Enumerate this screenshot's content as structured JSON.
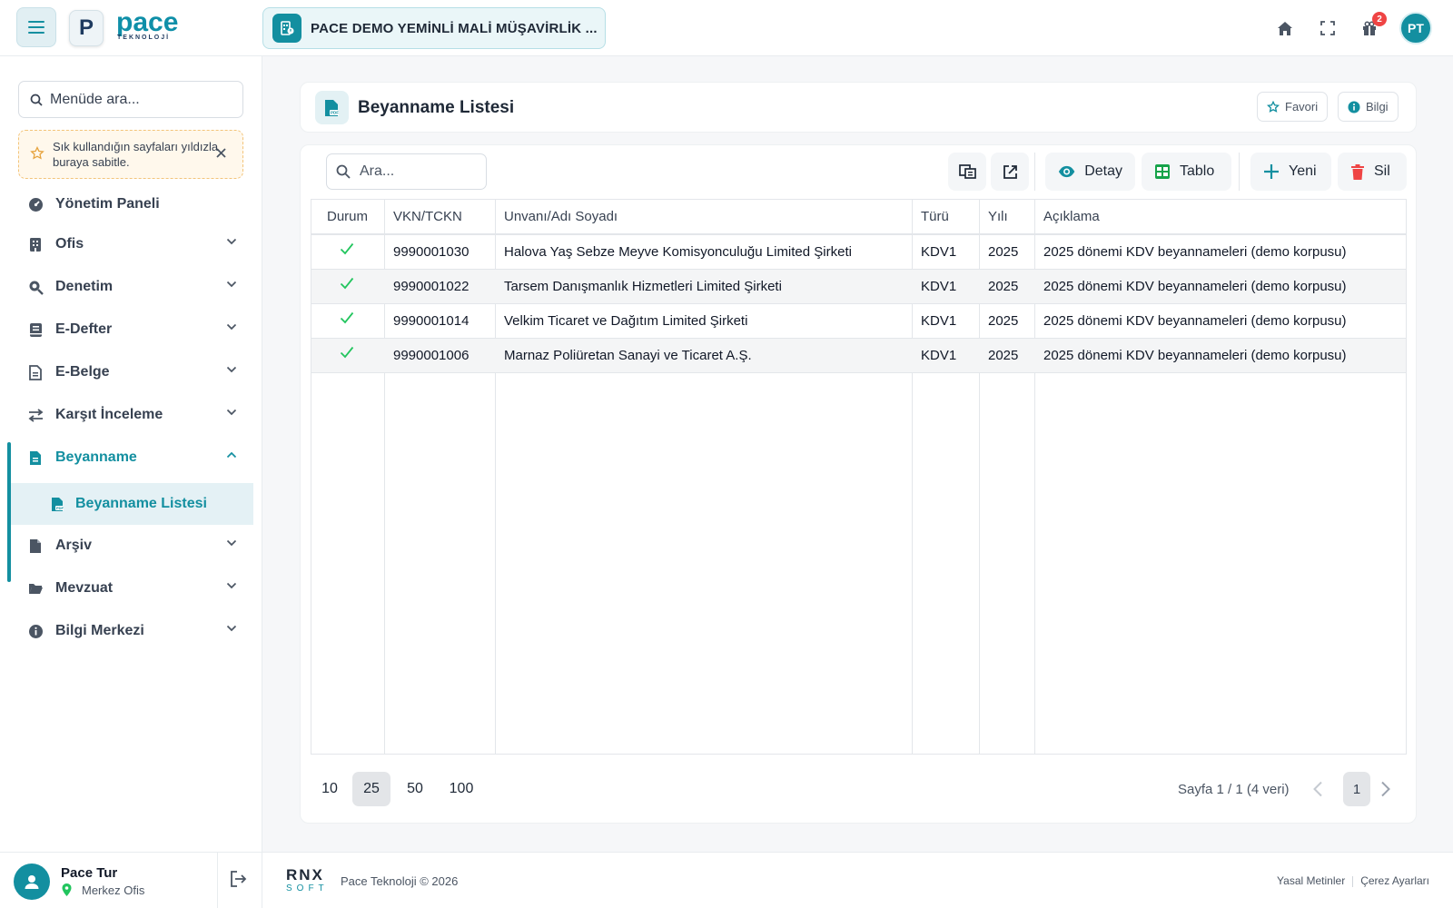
{
  "topbar": {
    "brand": "pace",
    "brand_sub": "TEKNOLOJİ",
    "logo_letter": "P",
    "office_name": "PACE DEMO YEMİNLİ MALİ MÜŞAVİRLİK ...",
    "notification_count": "2",
    "avatar_initials": "PT",
    "accent_color": "#138fa0"
  },
  "sidebar": {
    "search_placeholder": "Menüde ara...",
    "tip_text": "Sık kullandığın sayfaları yıldızla buraya sabitle.",
    "items": [
      {
        "label": "Yönetim Paneli",
        "icon": "gauge-icon"
      },
      {
        "label": "Ofis",
        "icon": "building-icon"
      },
      {
        "label": "Denetim",
        "icon": "audit-search-icon"
      },
      {
        "label": "E-Defter",
        "icon": "book-icon"
      },
      {
        "label": "E-Belge",
        "icon": "document-icon"
      },
      {
        "label": "Karşıt İnceleme",
        "icon": "arrows-exchange-icon"
      },
      {
        "label": "Beyanname",
        "icon": "file-text-icon"
      },
      {
        "label": "Arşiv",
        "icon": "archive-file-icon"
      },
      {
        "label": "Mevzuat",
        "icon": "folder-open-icon"
      },
      {
        "label": "Bilgi Merkezi",
        "icon": "info-circle-icon"
      }
    ],
    "sub_item": {
      "label": "Beyanname Listesi",
      "icon": "pdf-file-icon"
    }
  },
  "user": {
    "name": "Pace Tur",
    "office": "Merkez Ofis"
  },
  "footer": {
    "logo_text": "RNX",
    "logo_sub": "SOFT",
    "copyright": "Pace Teknoloji © 2026",
    "link_legal": "Yasal Metinler",
    "link_cookies": "Çerez Ayarları"
  },
  "page": {
    "title": "Beyanname Listesi",
    "favorite_label": "Favori",
    "info_label": "Bilgi"
  },
  "toolbar": {
    "search_placeholder": "Ara...",
    "detail_label": "Detay",
    "table_label": "Tablo",
    "new_label": "Yeni",
    "delete_label": "Sil"
  },
  "table": {
    "columns": [
      "Durum",
      "VKN/TCKN",
      "Unvanı/Adı Soyadı",
      "Türü",
      "Yılı",
      "Açıklama"
    ],
    "rows": [
      {
        "status": "ok",
        "vkn": "9990001030",
        "name": "Halova Yaş Sebze Meyve Komisyonculuğu Limited Şirketi",
        "type": "KDV1",
        "year": "2025",
        "desc": "2025 dönemi KDV beyannameleri (demo korpusu)"
      },
      {
        "status": "ok",
        "vkn": "9990001022",
        "name": "Tarsem Danışmanlık Hizmetleri Limited Şirketi",
        "type": "KDV1",
        "year": "2025",
        "desc": "2025 dönemi KDV beyannameleri (demo korpusu)"
      },
      {
        "status": "ok",
        "vkn": "9990001014",
        "name": "Velkim Ticaret ve Dağıtım Limited Şirketi",
        "type": "KDV1",
        "year": "2025",
        "desc": "2025 dönemi KDV beyannameleri (demo korpusu)"
      },
      {
        "status": "ok",
        "vkn": "9990001006",
        "name": "Marnaz Poliüretan Sanayi ve Ticaret A.Ş.",
        "type": "KDV1",
        "year": "2025",
        "desc": "2025 dönemi KDV beyannameleri (demo korpusu)"
      }
    ]
  },
  "pagination": {
    "sizes": [
      "10",
      "25",
      "50",
      "100"
    ],
    "selected_size": "25",
    "info": "Sayfa 1 / 1 (4 veri)",
    "current_page": "1"
  }
}
